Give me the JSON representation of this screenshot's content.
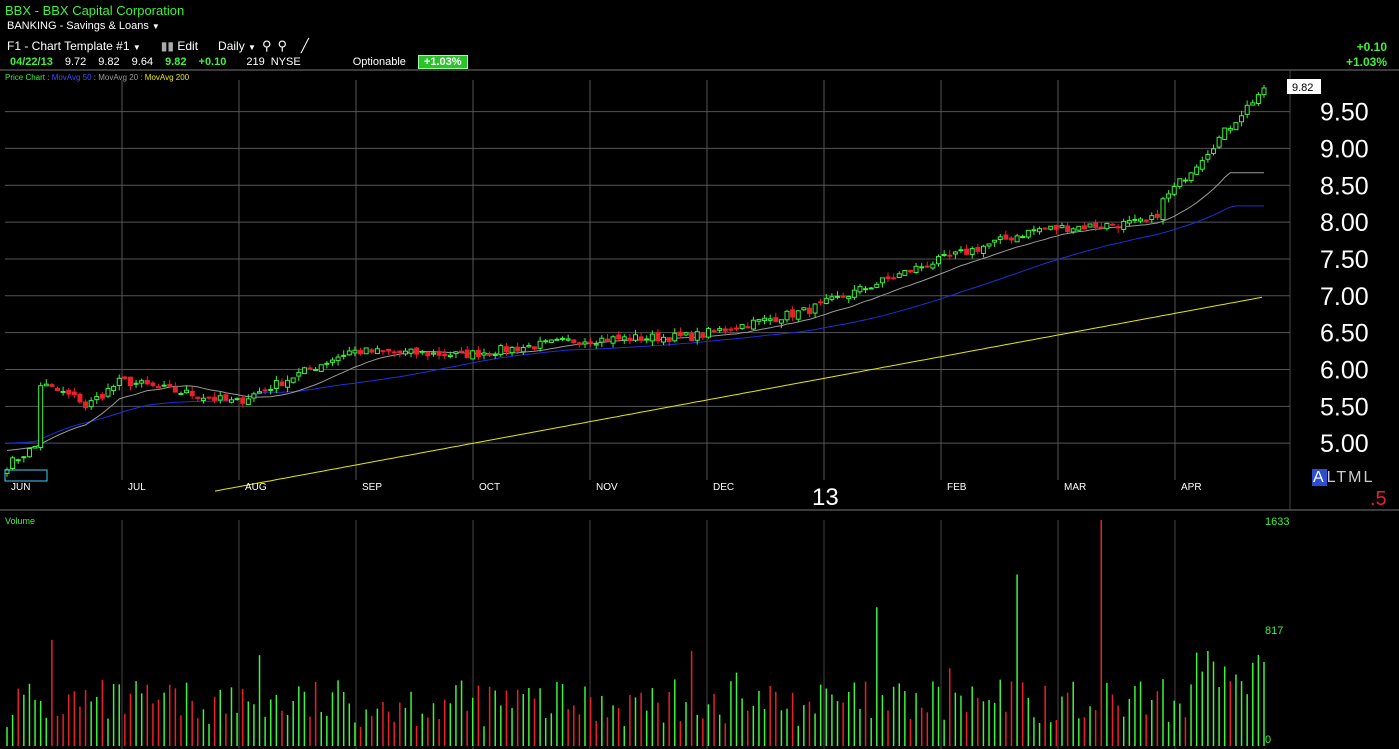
{
  "header": {
    "title": "BBX - BBX Capital Corporation",
    "sector": "BANKING - Savings & Loans",
    "template": "F1 - Chart Template #1",
    "edit_label": "Edit",
    "period": "Daily",
    "quote": {
      "date": "04/22/13",
      "open": "9.72",
      "high": "9.82",
      "low": "9.64",
      "close": "9.82",
      "change": "+0.10",
      "volume": "219",
      "exchange": "NYSE",
      "optionable_label": "Optionable",
      "change_pct": "+1.03%"
    },
    "right_change": "+0.10",
    "right_change_pct": "+1.03%"
  },
  "legend": {
    "price": "Price Chart",
    "ma50": "MovAvg 50",
    "ma20": "MovAvg 20",
    "ma200": "MovAvg 200",
    "separator": " : "
  },
  "timeframe": {
    "items": [
      "A",
      "L",
      "T",
      "M",
      "L"
    ],
    "active_index": 0
  },
  "volume_panel": {
    "label": "Volume"
  },
  "colors": {
    "up": "#3ef23e",
    "down": "#e8202a",
    "ma50": "#1f2fd8",
    "ma20": "#9a9a9a",
    "ma200": "#e6e600",
    "grid": "#555555",
    "last_price_box": "#ffffff"
  },
  "chart_data": [
    {
      "type": "candlestick",
      "title": "BBX - BBX Capital Corporation",
      "period": "Daily",
      "x_ticks": [
        "JUN",
        "JUL",
        "AUG",
        "SEP",
        "OCT",
        "NOV",
        "DEC",
        "13",
        "FEB",
        "MAR",
        "APR"
      ],
      "y_ticks": [
        "5.00",
        "5.50",
        "6.00",
        "6.50",
        "7.00",
        "7.50",
        "8.00",
        "8.50",
        "9.00",
        "9.50"
      ],
      "ylim": [
        4.5,
        9.82
      ],
      "last_price": "9.82",
      "grid": true,
      "legend_position": "top-left",
      "close_by_month": [
        {
          "month": "JUN",
          "close": 5.85
        },
        {
          "month": "JUL",
          "close": 5.55
        },
        {
          "month": "AUG",
          "close": 6.25
        },
        {
          "month": "SEP",
          "close": 6.2
        },
        {
          "month": "OCT",
          "close": 6.4
        },
        {
          "month": "NOV",
          "close": 6.45
        },
        {
          "month": "DEC",
          "close": 6.8
        },
        {
          "month": "13",
          "close": 7.4
        },
        {
          "month": "FEB",
          "close": 7.9
        },
        {
          "month": "MAR",
          "close": 8.0
        },
        {
          "month": "APR",
          "close": 9.82
        }
      ],
      "series": [
        {
          "name": "MovAvg 50",
          "start": 5.0,
          "end": 8.2
        },
        {
          "name": "MovAvg 20",
          "start": 4.9,
          "end": 8.65
        },
        {
          "name": "MovAvg 200",
          "start": 4.35,
          "end": 6.98
        }
      ]
    },
    {
      "type": "bar",
      "title": "Volume",
      "y_ticks": [
        "0",
        "817",
        "1633"
      ],
      "ylim": [
        0,
        1633
      ],
      "max_value": 1633
    }
  ]
}
